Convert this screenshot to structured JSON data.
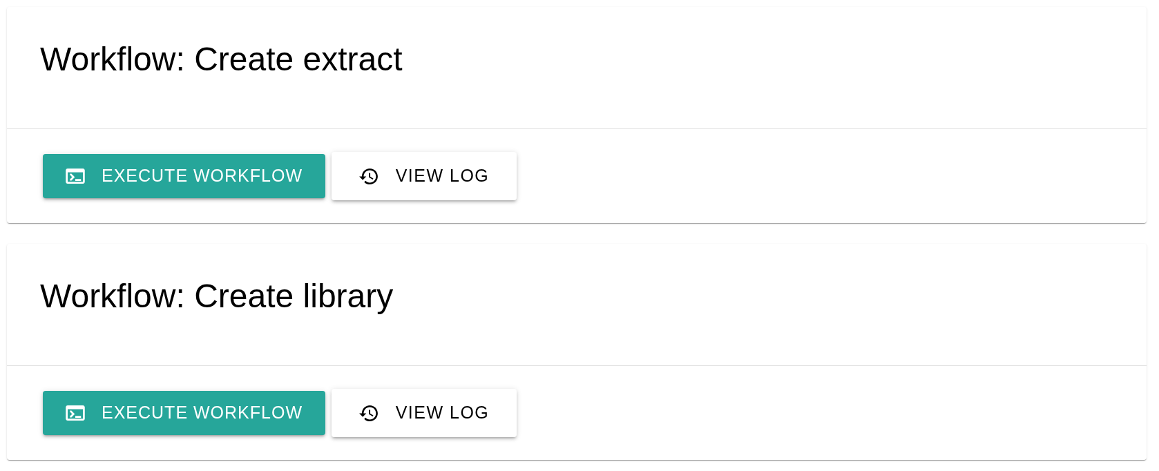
{
  "workflows": [
    {
      "title": "Workflow: Create extract",
      "actions": [
        {
          "kind": "primary",
          "label": "EXECUTE WORKFLOW"
        },
        {
          "kind": "secondary",
          "label": "VIEW LOG"
        }
      ]
    },
    {
      "title": "Workflow: Create library",
      "actions": [
        {
          "kind": "primary",
          "label": "EXECUTE WORKFLOW"
        },
        {
          "kind": "secondary",
          "label": "VIEW LOG"
        }
      ]
    }
  ]
}
